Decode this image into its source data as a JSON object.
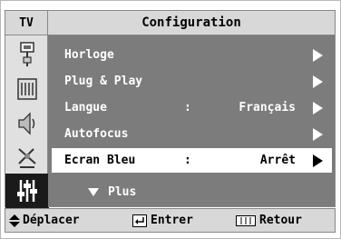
{
  "header": {
    "tv_label": "TV",
    "title": "Configuration"
  },
  "sidebar": {
    "icons": [
      "picture-icon",
      "channel-icon",
      "sound-icon",
      "setup-satellite-icon",
      "function-sliders-icon"
    ],
    "active_index": 4
  },
  "menu": {
    "items": [
      {
        "label": "Horloge",
        "value": "",
        "has_arrow": true,
        "selected": false
      },
      {
        "label": "Plug & Play",
        "value": "",
        "has_arrow": true,
        "selected": false
      },
      {
        "label": "Langue",
        "colon": ":",
        "value": "Français",
        "has_arrow": true,
        "selected": false
      },
      {
        "label": "Autofocus",
        "value": "",
        "has_arrow": true,
        "selected": false
      },
      {
        "label": "Ecran Bleu",
        "colon": ":",
        "value": "Arrêt",
        "has_arrow": true,
        "selected": true
      }
    ],
    "more_label": "Plus"
  },
  "footer": {
    "move_label": "Déplacer",
    "enter_label": "Entrer",
    "return_label": "Retour"
  },
  "colors": {
    "panel_bg": "#7c7c7c",
    "bar_bg": "#d8d8d8",
    "selected_bg": "#ffffff"
  }
}
